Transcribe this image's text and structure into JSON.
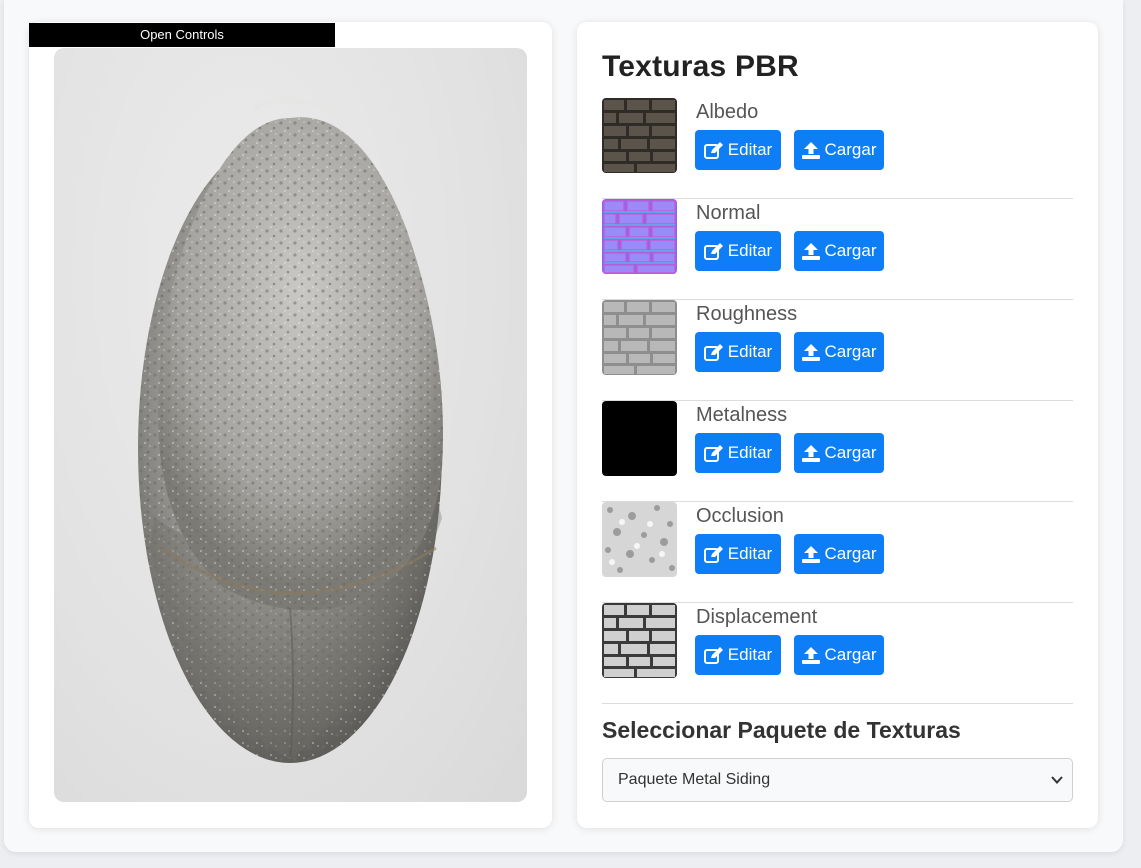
{
  "viewer": {
    "open_controls_label": "Open Controls"
  },
  "panel": {
    "title": "Texturas PBR",
    "textures": [
      {
        "name": "Albedo",
        "edit_label": "Editar",
        "load_label": "Cargar",
        "thumb_icon": "albedo-texture"
      },
      {
        "name": "Normal",
        "edit_label": "Editar",
        "load_label": "Cargar",
        "thumb_icon": "normal-texture"
      },
      {
        "name": "Roughness",
        "edit_label": "Editar",
        "load_label": "Cargar",
        "thumb_icon": "roughness-texture"
      },
      {
        "name": "Metalness",
        "edit_label": "Editar",
        "load_label": "Cargar",
        "thumb_icon": "metalness-texture"
      },
      {
        "name": "Occlusion",
        "edit_label": "Editar",
        "load_label": "Cargar",
        "thumb_icon": "occlusion-texture"
      },
      {
        "name": "Displacement",
        "edit_label": "Editar",
        "load_label": "Cargar",
        "thumb_icon": "displacement-texture"
      }
    ],
    "package_section_title": "Seleccionar Paquete de Texturas",
    "package_select": {
      "selected": "Paquete Metal Siding"
    }
  },
  "colors": {
    "accent": "#0d7ef5",
    "card_bg": "#ffffff",
    "page_bg": "#f8f9fa"
  }
}
